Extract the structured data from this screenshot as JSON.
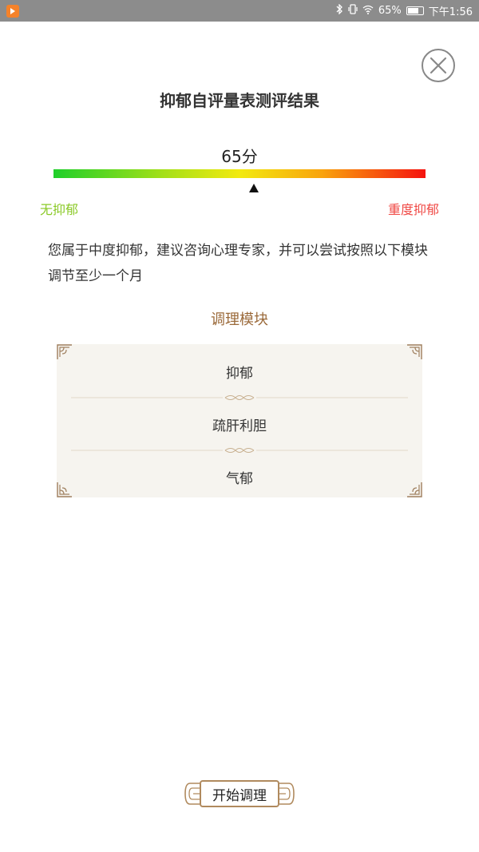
{
  "status_bar": {
    "battery": "65%",
    "time": "下午1:56"
  },
  "title": "抑郁自评量表测评结果",
  "score": {
    "value": 65,
    "text": "65分",
    "min": 0,
    "max": 100
  },
  "gauge": {
    "left_label": "无抑郁",
    "right_label": "重度抑郁",
    "left_color": "#8ac926",
    "right_color": "#f04a46"
  },
  "description": "您属于中度抑郁，建议咨询心理专家，并可以尝试按照以下模块调节至少一个月",
  "modules": {
    "title": "调理模块",
    "items": [
      {
        "label": "抑郁"
      },
      {
        "label": "疏肝利胆"
      },
      {
        "label": "气郁"
      }
    ]
  },
  "actions": {
    "start_label": "开始调理"
  },
  "colors": {
    "accent": "#9b6a3a",
    "border": "#b08a5e",
    "status_bar": "#8c8c8c"
  }
}
